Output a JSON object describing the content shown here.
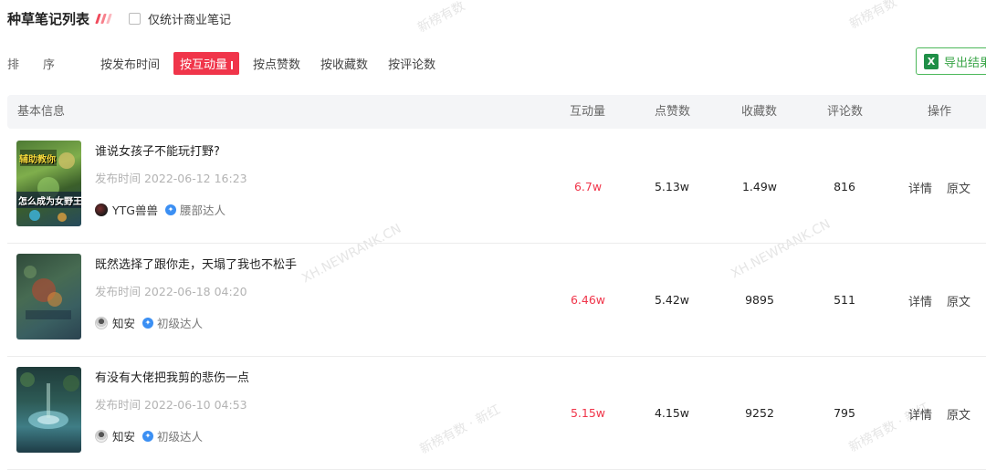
{
  "header": {
    "title": "种草笔记列表",
    "checkbox_label": "仅统计商业笔记"
  },
  "sort": {
    "label": "排序",
    "options": [
      "按发布时间",
      "按互动量",
      "按点赞数",
      "按收藏数",
      "按评论数"
    ],
    "active": "按互动量"
  },
  "export": {
    "label": "导出结果",
    "icon": "excel-icon"
  },
  "table": {
    "columns": {
      "basic": "基本信息",
      "interaction": "互动量",
      "likes": "点赞数",
      "favorites": "收藏数",
      "comments": "评论数",
      "actions": "操作"
    },
    "rows": [
      {
        "title": "谁说女孩子不能玩打野?",
        "publish_time": "发布时间 2022-06-12 16:23",
        "author": "YTG兽兽",
        "badge": "腰部达人",
        "interaction": "6.7w",
        "likes": "5.13w",
        "favorites": "1.49w",
        "comments": "816",
        "detail": "详情",
        "original": "原文",
        "thumb_text_top": "辅助教你",
        "thumb_text_bottom": "怎么成为女野王"
      },
      {
        "title": "既然选择了跟你走，天塌了我也不松手",
        "publish_time": "发布时间 2022-06-18 04:20",
        "author": "知安",
        "badge": "初级达人",
        "interaction": "6.46w",
        "likes": "5.42w",
        "favorites": "9895",
        "comments": "511",
        "detail": "详情",
        "original": "原文"
      },
      {
        "title": "有没有大佬把我剪的悲伤一点",
        "publish_time": "发布时间 2022-06-10 04:53",
        "author": "知安",
        "badge": "初级达人",
        "interaction": "5.15w",
        "likes": "4.15w",
        "favorites": "9252",
        "comments": "795",
        "detail": "详情",
        "original": "原文"
      }
    ]
  },
  "watermarks": [
    "新榜有数",
    "新榜有数",
    "XH.NEWRANK.CN",
    "XH.NEWRANK.CN",
    "新榜有数 · 新红",
    "新榜有数 · 新红"
  ]
}
